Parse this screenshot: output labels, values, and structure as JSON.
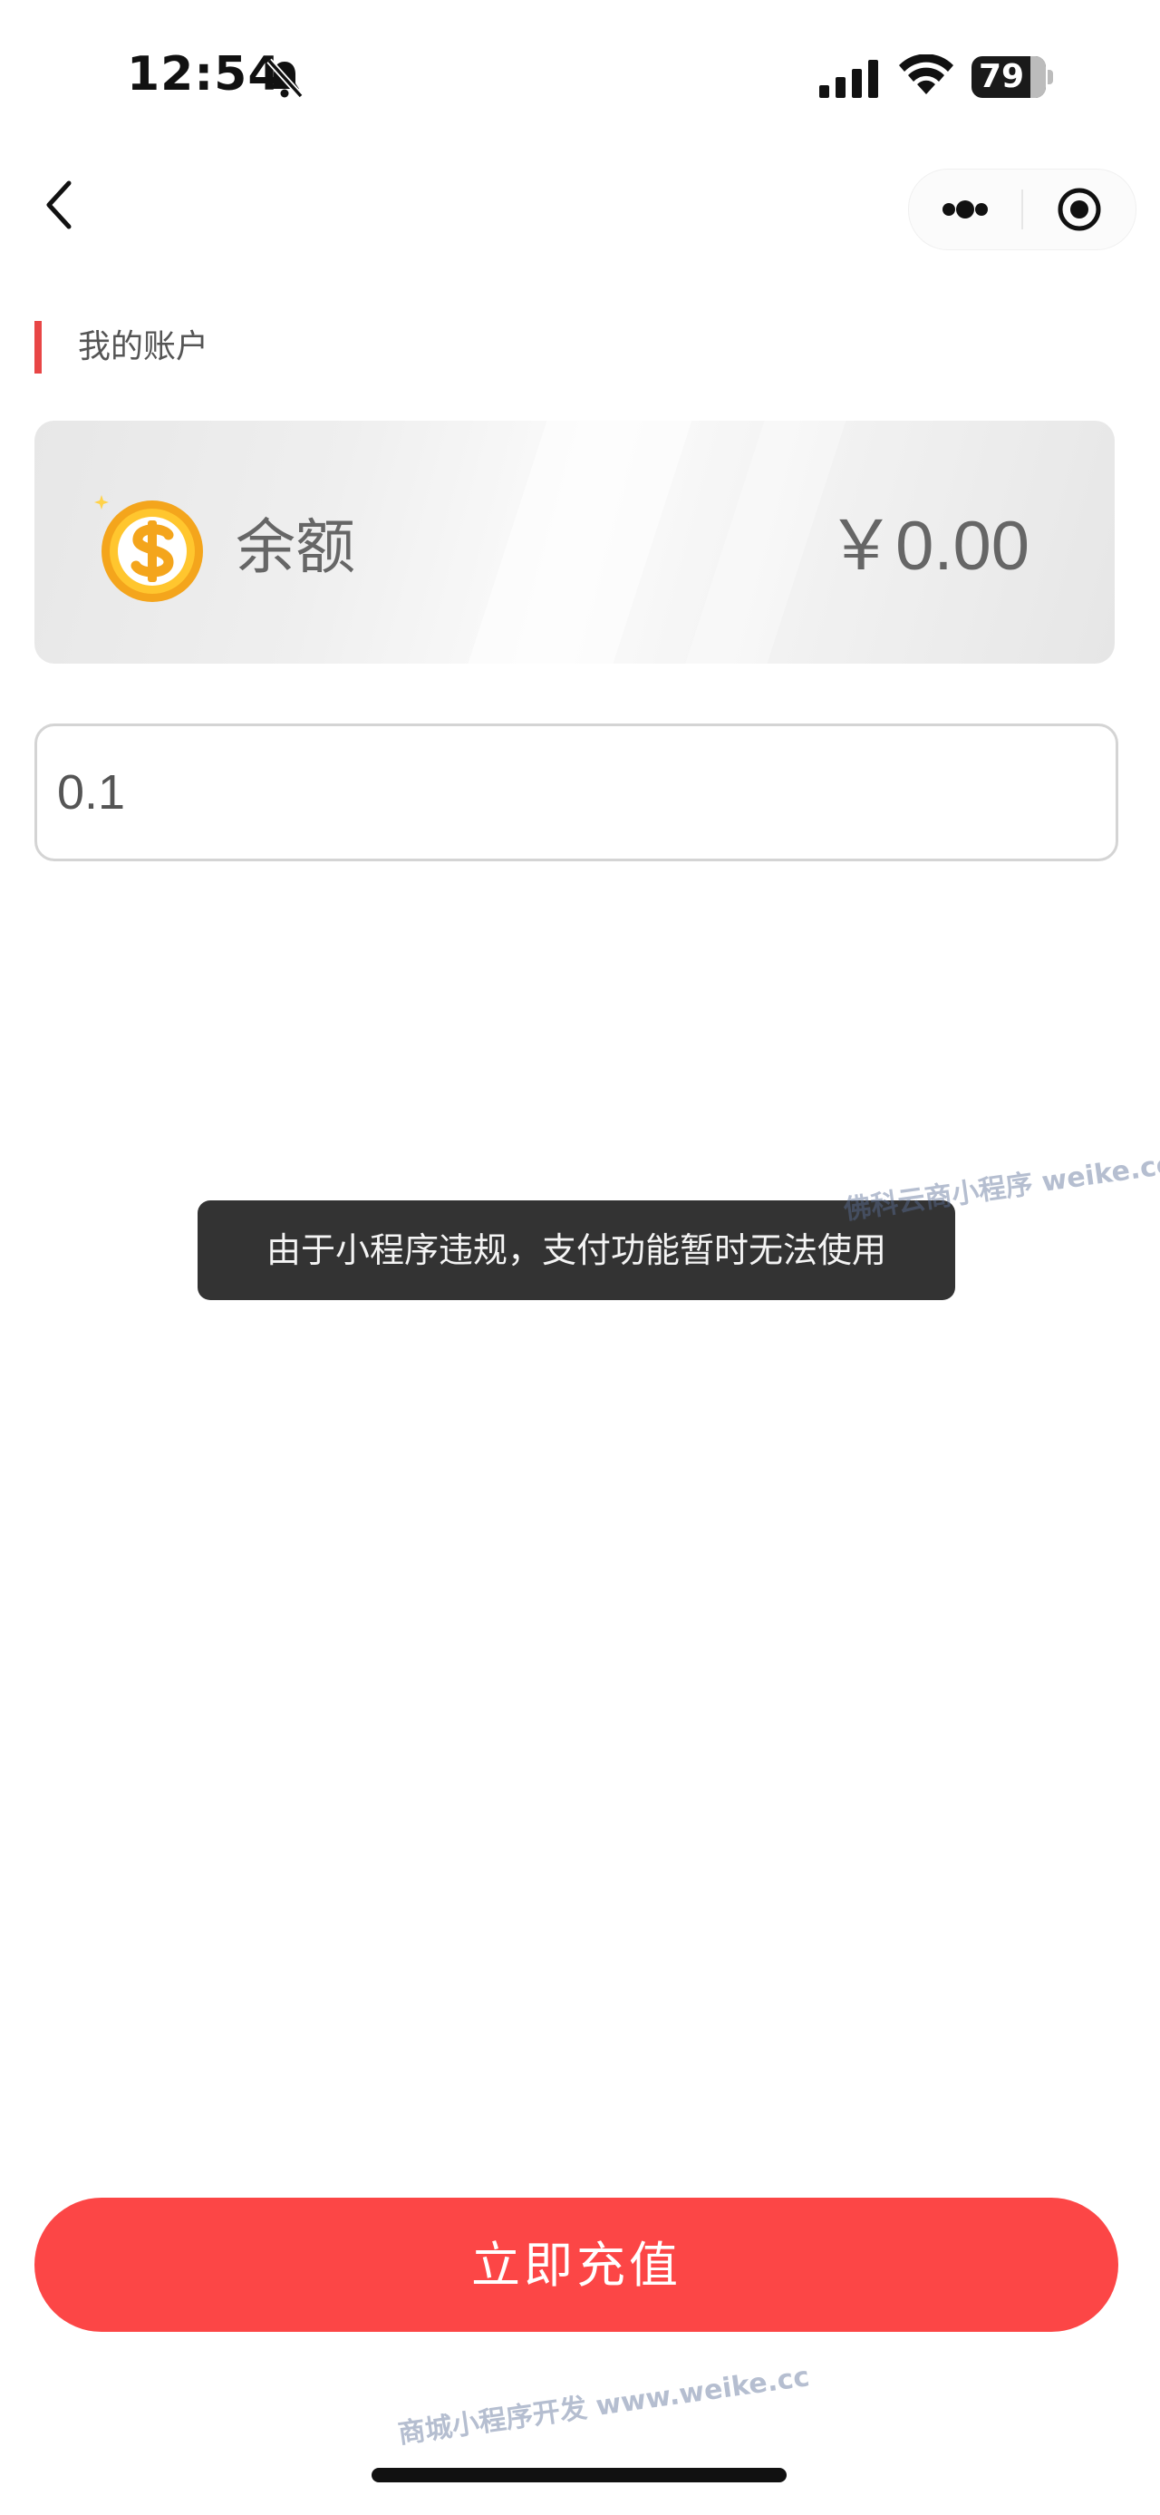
{
  "status_bar": {
    "time": "12:54",
    "battery_level": "79",
    "battery_fraction": 0.79
  },
  "nav": {
    "back_icon": "chevron-left-icon",
    "more_icon": "more-dots-icon",
    "close_icon": "target-circle-icon"
  },
  "section": {
    "title": "我的账户",
    "accent_color": "#e84646"
  },
  "balance_card": {
    "icon": "dollar-coin-icon",
    "label": "余额",
    "value": "￥0.00"
  },
  "amount_input": {
    "value": "0.1"
  },
  "toast": {
    "message": "由于小程序违规，支付功能暂时无法使用"
  },
  "watermarks": {
    "top": "佛科云商小程序  weike.cc",
    "bottom": "商城小程序开发  www.weike.cc"
  },
  "recharge_button": {
    "label": "立即充值",
    "color": "#fc4646"
  }
}
